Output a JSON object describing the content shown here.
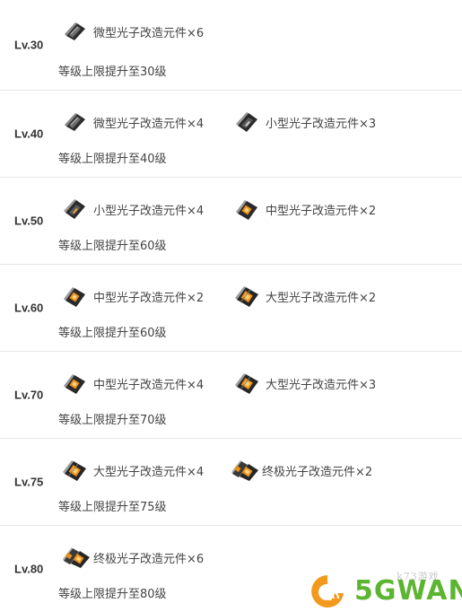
{
  "rows": [
    {
      "level": "Lv.30",
      "items": [
        {
          "icon": "micro-photon-module-icon",
          "label": "微型光子改造元件×6"
        }
      ],
      "effect": "等级上限提升至30级"
    },
    {
      "level": "Lv.40",
      "items": [
        {
          "icon": "micro-photon-module-icon",
          "label": "微型光子改造元件×4"
        },
        {
          "icon": "small-photon-module-icon",
          "label": "小型光子改造元件×3"
        }
      ],
      "effect": "等级上限提升至40级"
    },
    {
      "level": "Lv.50",
      "items": [
        {
          "icon": "small-photon-module-icon",
          "label": "小型光子改造元件×4"
        },
        {
          "icon": "medium-photon-module-icon",
          "label": "中型光子改造元件×2"
        }
      ],
      "effect": "等级上限提升至60级"
    },
    {
      "level": "Lv.60",
      "items": [
        {
          "icon": "medium-photon-module-icon",
          "label": "中型光子改造元件×2"
        },
        {
          "icon": "large-photon-module-icon",
          "label": "大型光子改造元件×2"
        }
      ],
      "effect": "等级上限提升至60级"
    },
    {
      "level": "Lv.70",
      "items": [
        {
          "icon": "medium-photon-module-icon",
          "label": "中型光子改造元件×4"
        },
        {
          "icon": "large-photon-module-icon",
          "label": "大型光子改造元件×3"
        }
      ],
      "effect": "等级上限提升至70级"
    },
    {
      "level": "Lv.75",
      "items": [
        {
          "icon": "large-photon-module-icon",
          "label": "大型光子改造元件×4"
        },
        {
          "icon": "ultimate-photon-module-icon",
          "label": "终极光子改造元件×2"
        }
      ],
      "effect": "等级上限提升至75级"
    },
    {
      "level": "Lv.80",
      "items": [
        {
          "icon": "ultimate-photon-module-icon",
          "label": "终极光子改造元件×6"
        }
      ],
      "effect": "等级上限提升至80级"
    }
  ],
  "watermark": {
    "site_text": "k73游戏",
    "logo_text": "5GWAN"
  },
  "colors": {
    "logo_orange": "#f39a1e",
    "logo_green": "#5cb531",
    "chip_orange": "#e8901c",
    "chip_dark": "#3a3a3a"
  }
}
